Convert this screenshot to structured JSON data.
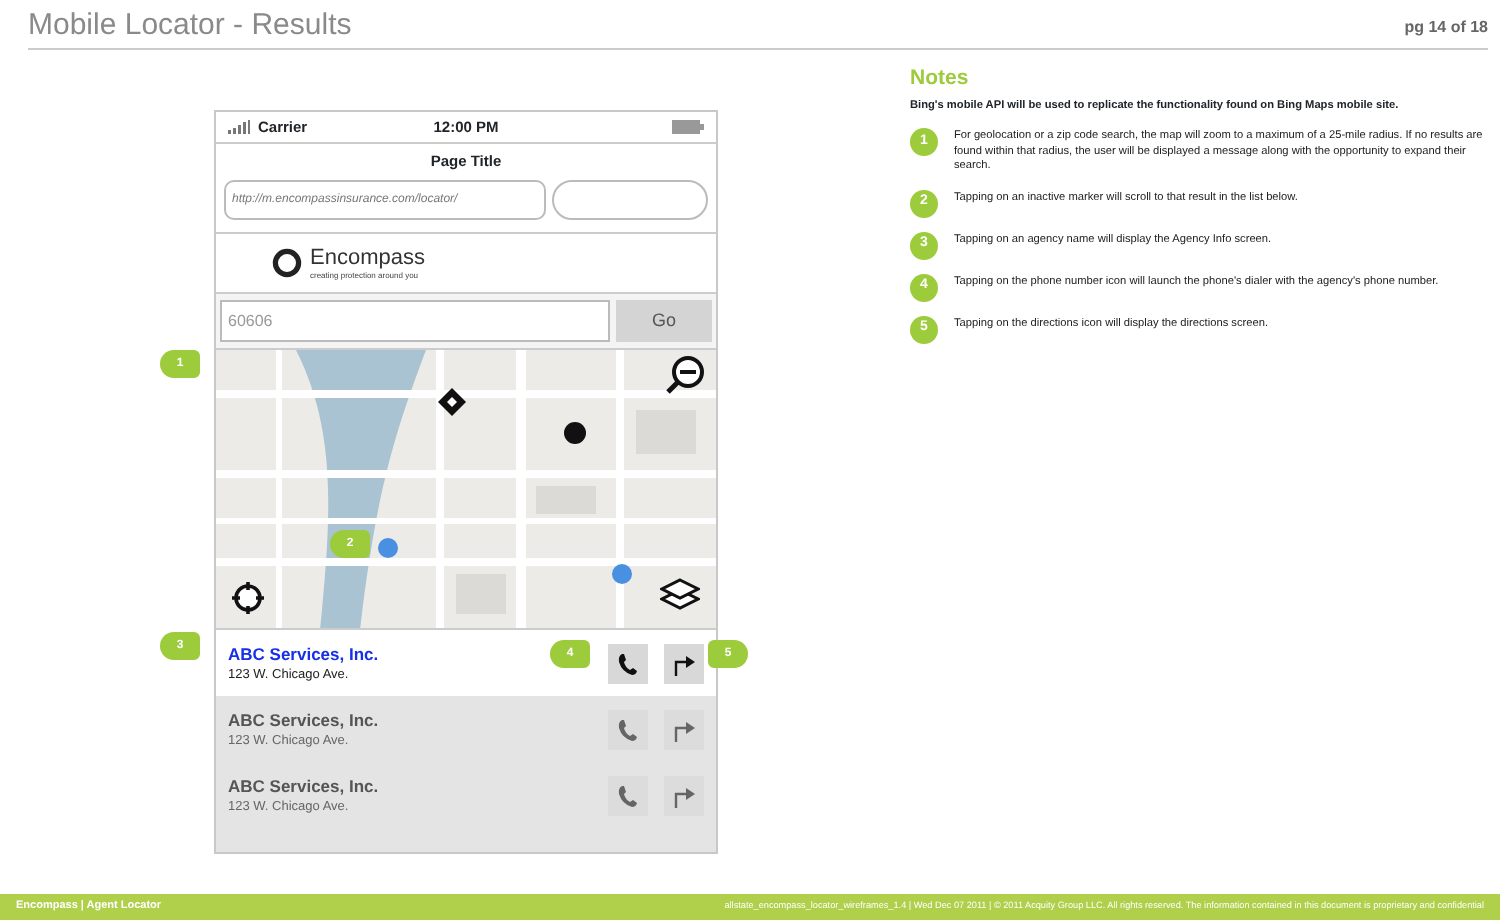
{
  "header": {
    "title": "Mobile Locator - Results",
    "page": "pg 14 of 18"
  },
  "phone": {
    "carrier": "Carrier",
    "time": "12:00 PM",
    "page_title": "Page Title",
    "url": "http://m.encompassinsurance.com/locator/",
    "logo": {
      "name": "Encompass",
      "tagline": "creating protection around you"
    },
    "search": {
      "value": "60606",
      "button": "Go"
    },
    "results": [
      {
        "name": "ABC Services, Inc.",
        "address": "123 W. Chicago Ave.",
        "selected": true
      },
      {
        "name": "ABC Services, Inc.",
        "address": "123 W. Chicago Ave.",
        "selected": false
      },
      {
        "name": "ABC Services, Inc.",
        "address": "123 W. Chicago Ave.",
        "selected": false
      }
    ]
  },
  "callouts": [
    "1",
    "2",
    "3",
    "4",
    "5"
  ],
  "notes": {
    "title": "Notes",
    "intro": "Bing's mobile API will be used to replicate the functionality found on Bing Maps mobile site.",
    "items": [
      {
        "number": "1",
        "text": "For geolocation or a zip code search, the map will zoom to a maximum of a 25-mile radius. If no results are found within that radius, the user will be displayed a message along with the opportunity to expand their search."
      },
      {
        "number": "2",
        "text": "Tapping on an inactive marker will scroll to that result in the list below."
      },
      {
        "number": "3",
        "text": "Tapping on an agency name will display the Agency Info screen."
      },
      {
        "number": "4",
        "text": "Tapping on the phone number icon will launch the phone's dialer with the agency's phone number."
      },
      {
        "number": "5",
        "text": "Tapping on the directions icon will display the directions screen."
      }
    ]
  },
  "footer": {
    "left": "Encompass | Agent Locator",
    "right": "allstate_encompass_locator_wireframes_1.4  |  Wed Dec 07 2011  |  © 2011 Acquity Group LLC. All rights reserved. The information contained in this document is proprietary and confidential"
  }
}
